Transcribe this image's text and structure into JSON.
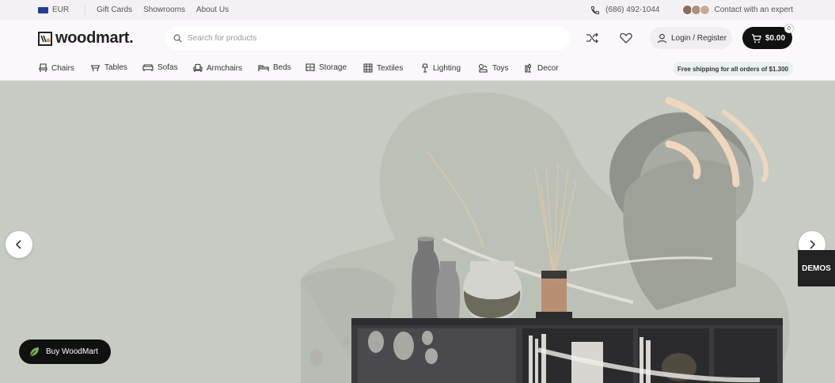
{
  "topbar": {
    "currency": "EUR",
    "links": [
      "Gift Cards",
      "Showrooms",
      "About Us"
    ],
    "phone": "(686) 492-1044",
    "contact": "Contact with an expert"
  },
  "header": {
    "logo": "woodmart.",
    "search_placeholder": "Search for products",
    "login": "Login / Register",
    "cart_total": "$0.00",
    "cart_count": "0"
  },
  "nav": {
    "items": [
      {
        "label": "Chairs",
        "icon": "chair-icon"
      },
      {
        "label": "Tables",
        "icon": "table-icon"
      },
      {
        "label": "Sofas",
        "icon": "sofa-icon"
      },
      {
        "label": "Armchairs",
        "icon": "armchair-icon"
      },
      {
        "label": "Beds",
        "icon": "bed-icon"
      },
      {
        "label": "Storage",
        "icon": "storage-icon"
      },
      {
        "label": "Textiles",
        "icon": "textile-icon"
      },
      {
        "label": "Lighting",
        "icon": "lamp-icon"
      },
      {
        "label": "Toys",
        "icon": "toy-icon"
      },
      {
        "label": "Decor",
        "icon": "decor-icon"
      }
    ],
    "shipping": "Free shipping for all orders of $1.300"
  },
  "hero": {
    "demos_label": "DEMOS",
    "buy_label": "Buy WoodMart"
  },
  "colors": {
    "accent_dark": "#111111",
    "hero_bg": "#c6ccc3",
    "flag": "#1f3f99"
  }
}
